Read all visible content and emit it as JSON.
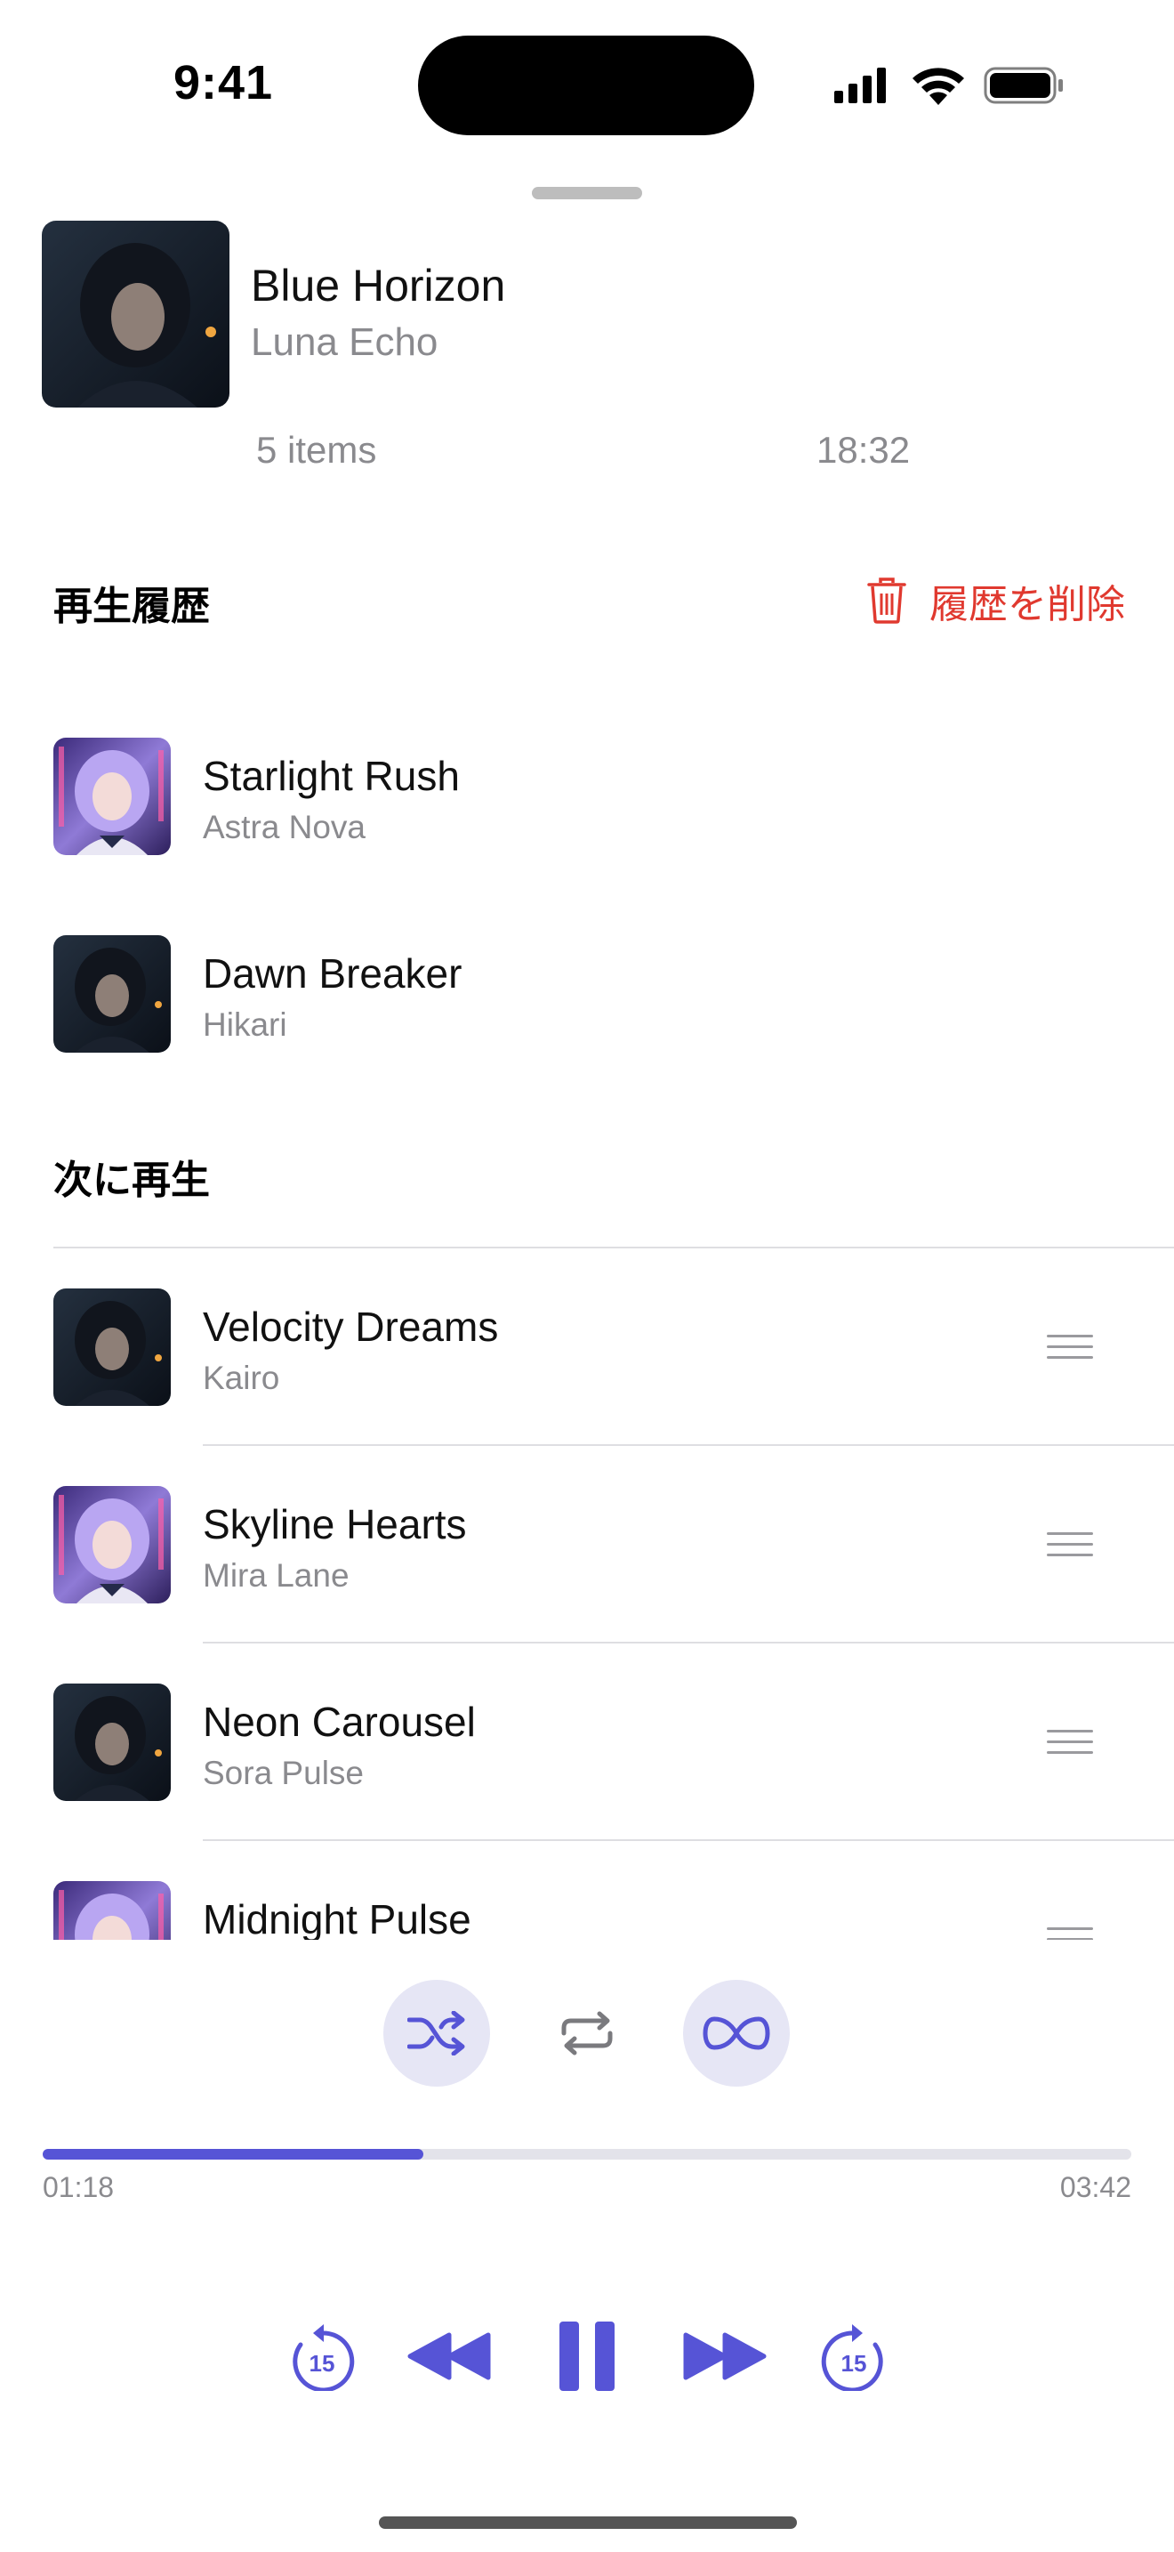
{
  "status_bar": {
    "time": "9:41"
  },
  "now_playing": {
    "title": "Blue Horizon",
    "artist": "Luna Echo",
    "items": "5 items",
    "total_duration": "18:32"
  },
  "history": {
    "title": "再生履歴",
    "clear_label": "履歴を削除",
    "tracks": [
      {
        "title": "Starlight Rush",
        "artist": "Astra Nova",
        "art": "purple"
      },
      {
        "title": "Dawn Breaker",
        "artist": "Hikari",
        "art": "dark"
      }
    ]
  },
  "up_next": {
    "title": "次に再生",
    "tracks": [
      {
        "title": "Velocity Dreams",
        "artist": "Kairo",
        "art": "dark"
      },
      {
        "title": "Skyline Hearts",
        "artist": "Mira Lane",
        "art": "purple"
      },
      {
        "title": "Neon Carousel",
        "artist": "Sora Pulse",
        "art": "dark"
      },
      {
        "title": "Midnight Pulse",
        "artist": "",
        "art": "purple"
      }
    ]
  },
  "modes": {
    "shuffle_active": true,
    "repeat_active": false,
    "infinity_active": true
  },
  "playback": {
    "progress_fraction": 0.35,
    "elapsed": "01:18",
    "duration": "03:42",
    "skip_seconds": "15"
  },
  "colors": {
    "accent": "#5654d6",
    "destructive": "#e0392f",
    "secondary_text": "#8a8a8e"
  }
}
